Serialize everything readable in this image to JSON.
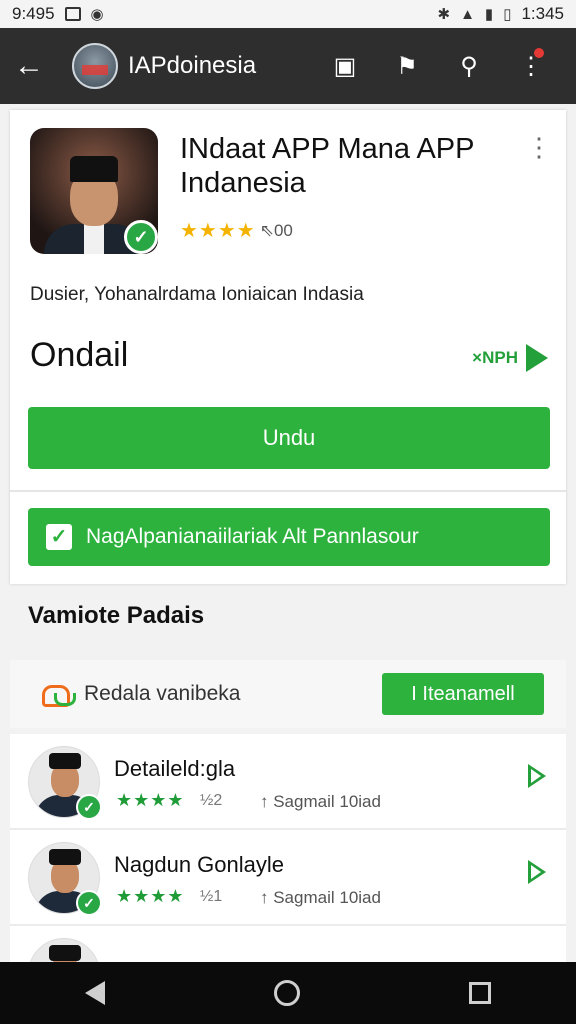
{
  "status_bar": {
    "time": "9:495",
    "clock_right": "1:345"
  },
  "app_bar": {
    "title": "IAPdoinesia"
  },
  "app": {
    "name": "INdaat APP Mana APP Indanesia",
    "rating_text": "⇖00",
    "description": "Dusier, Yohanalrdama Ioniaican Indasia",
    "price_label": "Ondail",
    "size": "×NPH",
    "install_label": "Undu",
    "permission_label": "NagAlpanianaiilariak Alt Pannlasour"
  },
  "section": {
    "title": "Vamiote Padais",
    "row_label": "Redala vanibeka",
    "button_label": "I Iteanamell"
  },
  "list": [
    {
      "title": "Detaileld:gla",
      "stars": "★★★★",
      "count": "½2",
      "meta": "↑ Sagmail 10iad"
    },
    {
      "title": "Nagdun Gonlayle",
      "stars": "★★★★",
      "count": "½1",
      "meta": "↑ Sagmail 10iad"
    }
  ],
  "colors": {
    "accent_green": "#2db23e",
    "app_bar": "#2e2e2e",
    "star_gold": "#f5b301"
  }
}
